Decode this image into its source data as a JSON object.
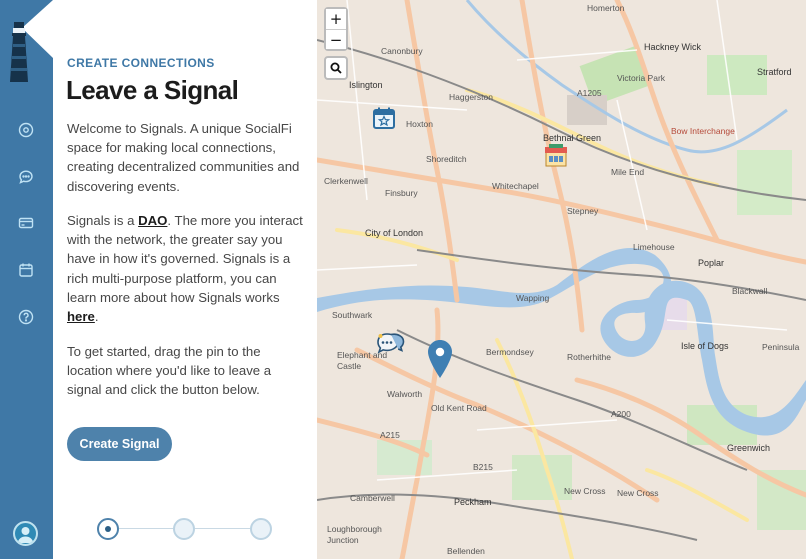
{
  "panel": {
    "eyebrow": "CREATE CONNECTIONS",
    "title": "Leave a Signal",
    "intro": "Welcome to Signals. A unique SocialFi space for making local connections, creating decentralized communities and discovering events.",
    "dao_prefix": "Signals is a ",
    "dao_link": "DAO",
    "dao_suffix": ". The more you interact with the network, the greater say you have in how it's governed. Signals is a rich multi-purpose platform, you can learn more about how Signals works ",
    "here_link": "here",
    "period": ".",
    "instructions": "To get started, drag the pin to the location where you'd like to leave a signal and click the button below.",
    "cta_label": "Create Signal"
  },
  "nav": {
    "items": [
      {
        "icon": "location-pin-icon"
      },
      {
        "icon": "chat-bubble-icon"
      },
      {
        "icon": "credit-card-icon"
      },
      {
        "icon": "calendar-icon"
      },
      {
        "icon": "help-circle-icon"
      }
    ]
  },
  "stepper": {
    "total": 3,
    "current": 1
  },
  "map": {
    "zoom_in": "+",
    "zoom_out": "−",
    "labels": [
      "Homerton",
      "Canonbury",
      "Hackney Wick",
      "Stratford",
      "Islington",
      "Haggerston",
      "A1205",
      "Hoxton",
      "Bethnal Green",
      "Victoria Park",
      "Bow Interchange",
      "Shoreditch",
      "Clerkenwell",
      "Mile End",
      "Finsbury",
      "Whitechapel",
      "Stepney",
      "City of London",
      "Limehouse",
      "Poplar",
      "Wapping",
      "Blackwall",
      "Southwark",
      "Rotherhithe",
      "Elephant and Castle",
      "Bermondsey",
      "Isle of Dogs",
      "Peninsula",
      "Walworth",
      "Old Kent Road",
      "A200",
      "A215",
      "Greenwich",
      "B215",
      "Camberwell",
      "Peckham",
      "New Cross",
      "New Cross",
      "Loughborough Junction",
      "Bellenden"
    ]
  },
  "colors": {
    "rail": "#3f78a6",
    "accent": "#3f78a6",
    "button": "#4e82ab",
    "river": "#a7c8e6",
    "map_bg": "#eee6dd"
  }
}
